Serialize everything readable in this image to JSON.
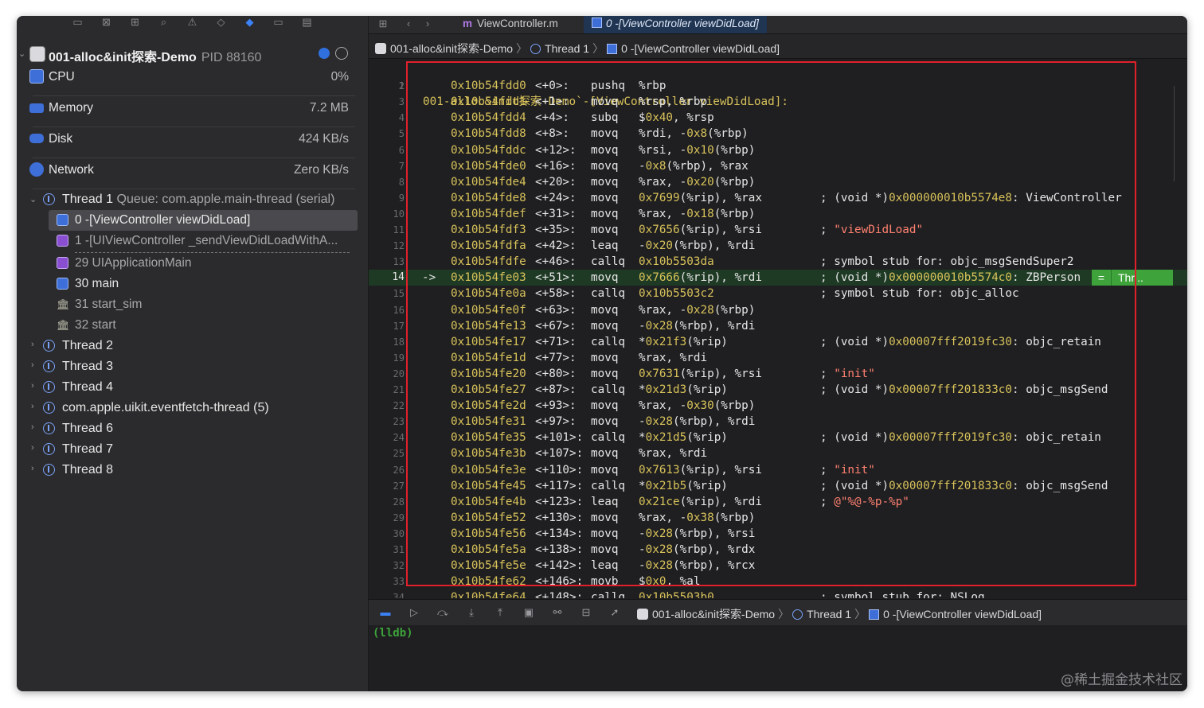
{
  "navigator": {
    "process": {
      "name": "001-alloc&init探索-Demo",
      "pid": "PID 88160"
    },
    "gauges": [
      {
        "label": "CPU",
        "value": "0%",
        "color": "#3e6fd8"
      },
      {
        "label": "Memory",
        "value": "7.2 MB",
        "color": "#3e6fd8"
      },
      {
        "label": "Disk",
        "value": "424 KB/s",
        "color": "#3e6fd8"
      },
      {
        "label": "Network",
        "value": "Zero KB/s",
        "color": "#3e6fd8"
      }
    ],
    "thread1": {
      "label": "Thread 1",
      "queue": "Queue: com.apple.main-thread (serial)"
    },
    "frames": [
      {
        "label": "0 -[ViewController viewDidLoad]",
        "icon": "user-frame-icon"
      },
      {
        "label": "1 -[UIViewController _sendViewDidLoadWithA...",
        "icon": "framework-frame-icon"
      },
      {
        "label": "29 UIApplicationMain",
        "icon": "framework-frame-icon"
      },
      {
        "label": "30 main",
        "icon": "user-frame-icon"
      },
      {
        "label": "31 start_sim",
        "icon": "library-frame-icon"
      },
      {
        "label": "32 start",
        "icon": "library-frame-icon"
      }
    ],
    "threads": [
      "Thread 2",
      "Thread 3",
      "Thread 4",
      "com.apple.uikit.eventfetch-thread (5)",
      "Thread 6",
      "Thread 7",
      "Thread 8"
    ]
  },
  "tabs": {
    "inactive": "ViewController.m",
    "active": "0 -[ViewController viewDidLoad]"
  },
  "jumpbar": {
    "app": "001-alloc&init探索-Demo",
    "thread": "Thread 1",
    "frame": "0 -[ViewController viewDidLoad]"
  },
  "code": {
    "header": "001-alloc&init探索-Demo`-[ViewController viewDidLoad]:",
    "current_line": 14,
    "current_badge": "Thr...",
    "lines": [
      {
        "addr": "0x10b54fdd0",
        "off": "<+0>:",
        "mn": "pushq",
        "op": "%rbp",
        "cmt": ""
      },
      {
        "addr": "0x10b54fdd1",
        "off": "<+1>:",
        "mn": "movq",
        "op": "%rsp, %rbp",
        "cmt": ""
      },
      {
        "addr": "0x10b54fdd4",
        "off": "<+4>:",
        "mn": "subq",
        "op": "$0x40, %rsp",
        "cmt": ""
      },
      {
        "addr": "0x10b54fdd8",
        "off": "<+8>:",
        "mn": "movq",
        "op": "%rdi, -0x8(%rbp)",
        "cmt": ""
      },
      {
        "addr": "0x10b54fddc",
        "off": "<+12>:",
        "mn": "movq",
        "op": "%rsi, -0x10(%rbp)",
        "cmt": ""
      },
      {
        "addr": "0x10b54fde0",
        "off": "<+16>:",
        "mn": "movq",
        "op": "-0x8(%rbp), %rax",
        "cmt": ""
      },
      {
        "addr": "0x10b54fde4",
        "off": "<+20>:",
        "mn": "movq",
        "op": "%rax, -0x20(%rbp)",
        "cmt": ""
      },
      {
        "addr": "0x10b54fde8",
        "off": "<+24>:",
        "mn": "movq",
        "op": "0x7699(%rip), %rax",
        "cmt": "; (void *)0x000000010b5574e8: ViewController"
      },
      {
        "addr": "0x10b54fdef",
        "off": "<+31>:",
        "mn": "movq",
        "op": "%rax, -0x18(%rbp)",
        "cmt": ""
      },
      {
        "addr": "0x10b54fdf3",
        "off": "<+35>:",
        "mn": "movq",
        "op": "0x7656(%rip), %rsi",
        "cmt": "; \"viewDidLoad\""
      },
      {
        "addr": "0x10b54fdfa",
        "off": "<+42>:",
        "mn": "leaq",
        "op": "-0x20(%rbp), %rdi",
        "cmt": ""
      },
      {
        "addr": "0x10b54fdfe",
        "off": "<+46>:",
        "mn": "callq",
        "op": "0x10b5503da",
        "cmt": "; symbol stub for: objc_msgSendSuper2"
      },
      {
        "addr": "0x10b54fe03",
        "off": "<+51>:",
        "mn": "movq",
        "op": "0x7666(%rip), %rdi",
        "cmt": "; (void *)0x000000010b5574c0: ZBPerson"
      },
      {
        "addr": "0x10b54fe0a",
        "off": "<+58>:",
        "mn": "callq",
        "op": "0x10b5503c2",
        "cmt": "; symbol stub for: objc_alloc"
      },
      {
        "addr": "0x10b54fe0f",
        "off": "<+63>:",
        "mn": "movq",
        "op": "%rax, -0x28(%rbp)",
        "cmt": ""
      },
      {
        "addr": "0x10b54fe13",
        "off": "<+67>:",
        "mn": "movq",
        "op": "-0x28(%rbp), %rdi",
        "cmt": ""
      },
      {
        "addr": "0x10b54fe17",
        "off": "<+71>:",
        "mn": "callq",
        "op": "*0x21f3(%rip)",
        "cmt": "; (void *)0x00007fff2019fc30: objc_retain"
      },
      {
        "addr": "0x10b54fe1d",
        "off": "<+77>:",
        "mn": "movq",
        "op": "%rax, %rdi",
        "cmt": ""
      },
      {
        "addr": "0x10b54fe20",
        "off": "<+80>:",
        "mn": "movq",
        "op": "0x7631(%rip), %rsi",
        "cmt": "; \"init\""
      },
      {
        "addr": "0x10b54fe27",
        "off": "<+87>:",
        "mn": "callq",
        "op": "*0x21d3(%rip)",
        "cmt": "; (void *)0x00007fff201833c0: objc_msgSend"
      },
      {
        "addr": "0x10b54fe2d",
        "off": "<+93>:",
        "mn": "movq",
        "op": "%rax, -0x30(%rbp)",
        "cmt": ""
      },
      {
        "addr": "0x10b54fe31",
        "off": "<+97>:",
        "mn": "movq",
        "op": "-0x28(%rbp), %rdi",
        "cmt": ""
      },
      {
        "addr": "0x10b54fe35",
        "off": "<+101>:",
        "mn": "callq",
        "op": "*0x21d5(%rip)",
        "cmt": "; (void *)0x00007fff2019fc30: objc_retain"
      },
      {
        "addr": "0x10b54fe3b",
        "off": "<+107>:",
        "mn": "movq",
        "op": "%rax, %rdi",
        "cmt": ""
      },
      {
        "addr": "0x10b54fe3e",
        "off": "<+110>:",
        "mn": "movq",
        "op": "0x7613(%rip), %rsi",
        "cmt": "; \"init\""
      },
      {
        "addr": "0x10b54fe45",
        "off": "<+117>:",
        "mn": "callq",
        "op": "*0x21b5(%rip)",
        "cmt": "; (void *)0x00007fff201833c0: objc_msgSend"
      },
      {
        "addr": "0x10b54fe4b",
        "off": "<+123>:",
        "mn": "leaq",
        "op": "0x21ce(%rip), %rdi",
        "cmt": "; @\"%@-%p-%p\""
      },
      {
        "addr": "0x10b54fe52",
        "off": "<+130>:",
        "mn": "movq",
        "op": "%rax, -0x38(%rbp)",
        "cmt": ""
      },
      {
        "addr": "0x10b54fe56",
        "off": "<+134>:",
        "mn": "movq",
        "op": "-0x28(%rbp), %rsi",
        "cmt": ""
      },
      {
        "addr": "0x10b54fe5a",
        "off": "<+138>:",
        "mn": "movq",
        "op": "-0x28(%rbp), %rdx",
        "cmt": ""
      },
      {
        "addr": "0x10b54fe5e",
        "off": "<+142>:",
        "mn": "leaq",
        "op": "-0x28(%rbp), %rcx",
        "cmt": ""
      },
      {
        "addr": "0x10b54fe62",
        "off": "<+146>:",
        "mn": "movb",
        "op": "$0x0, %al",
        "cmt": ""
      },
      {
        "addr": "0x10b54fe64",
        "off": "<+148>:",
        "mn": "callq",
        "op": "0x10b5503b0",
        "cmt": "; symbol stub for: NSLog"
      }
    ]
  },
  "debugbar": {
    "app": "001-alloc&init探索-Demo",
    "thread": "Thread 1",
    "frame": "0 -[ViewController viewDidLoad]"
  },
  "console": {
    "prompt": "(lldb)"
  },
  "watermark": "@稀土掘金技术社区",
  "colors": {
    "accent": "#3b82f6",
    "current_line": "#1e3a24",
    "pc_badge": "#3da33a",
    "highlight_box": "#e0202a",
    "address": "#d8c25a",
    "string": "#ff8170"
  }
}
